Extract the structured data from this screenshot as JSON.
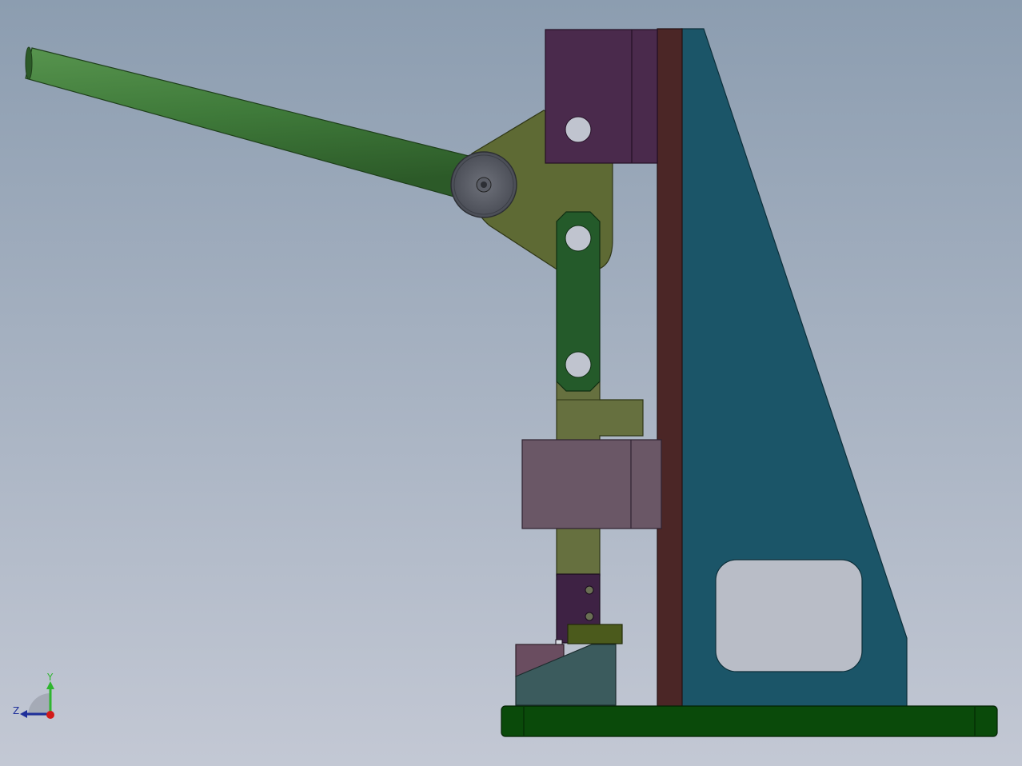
{
  "viewport": {
    "background_top": "#8c9db0",
    "background_bottom": "#c3c8d4"
  },
  "triad": {
    "y_label": "Y",
    "z_label": "Z",
    "y_color": "#2fb52f",
    "z_color": "#1f2f9a",
    "x_color": "#d21a1a"
  },
  "parts": {
    "handle": {
      "color": "#3f7a3a",
      "icon": "lever-handle"
    },
    "pivot_disc": {
      "color": "#5a5d66"
    },
    "lever_plate": {
      "color": "#5e6a34"
    },
    "top_block": {
      "color": "#4a2a4c"
    },
    "column_bar": {
      "color": "#4b2626"
    },
    "frame": {
      "color": "#1b5568"
    },
    "link_bar": {
      "color": "#245a2a"
    },
    "ram": {
      "color": "#66703f"
    },
    "guide_block": {
      "color": "#6a5766"
    },
    "punch_holder": {
      "color": "#3e2244"
    },
    "clamp": {
      "color": "#4b5a1c"
    },
    "wedge": {
      "color": "#3b5b5d"
    },
    "wedge_back": {
      "color": "#6a4d60"
    },
    "base": {
      "color": "#0a4a0a"
    }
  }
}
